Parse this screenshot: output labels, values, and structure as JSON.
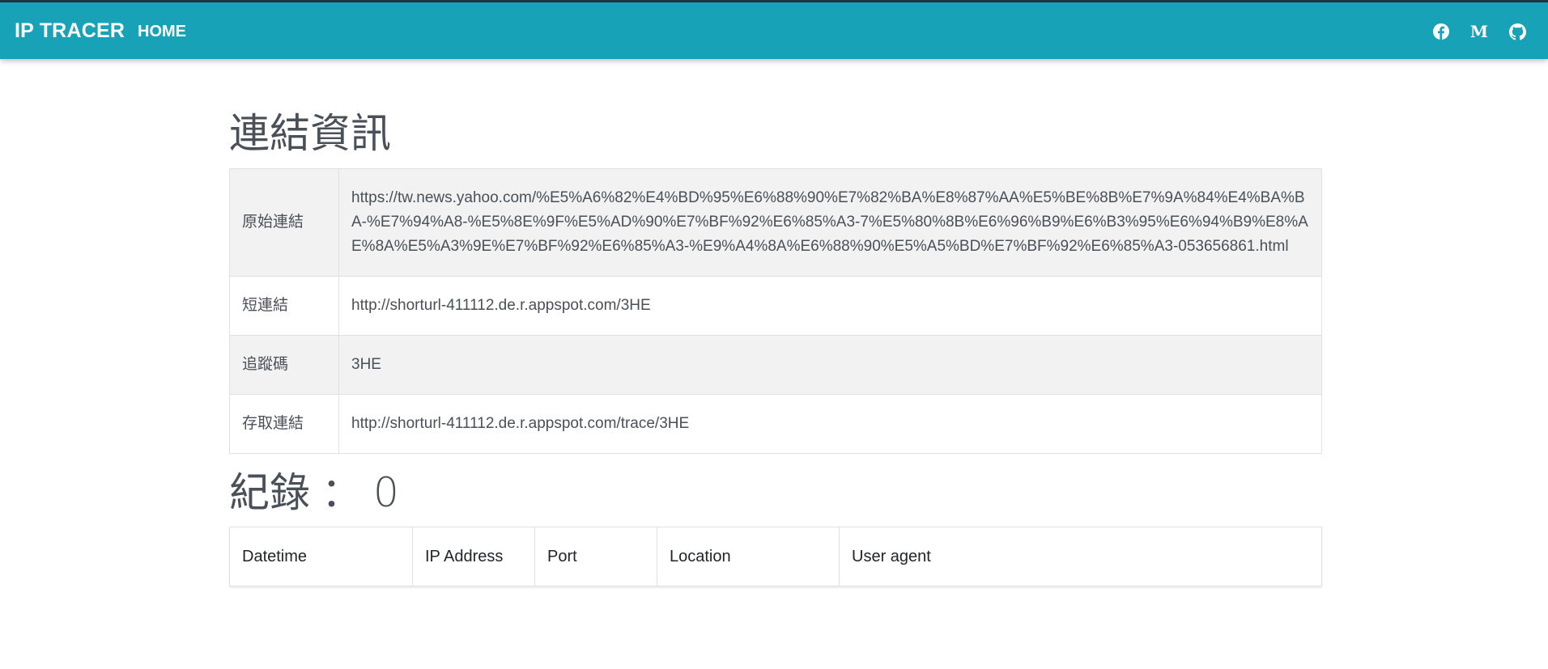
{
  "navbar": {
    "brand": "IP TRACER",
    "home": "HOME",
    "icons": [
      "facebook-icon",
      "medium-icon",
      "github-icon"
    ],
    "color": "#17a2b8"
  },
  "info": {
    "title": "連結資訊",
    "rows": [
      {
        "label": "原始連結",
        "value": "https://tw.news.yahoo.com/%E5%A6%82%E4%BD%95%E6%88%90%E7%82%BA%E8%87%AA%E5%BE%8B%E7%9A%84%E4%BA%BA-%E7%94%A8-%E5%8E%9F%E5%AD%90%E7%BF%92%E6%85%A3-7%E5%80%8B%E6%96%B9%E6%B3%95%E6%94%B9%E8%AE%8A%E5%A3%9E%E7%BF%92%E6%85%A3-%E9%A4%8A%E6%88%90%E5%A5%BD%E7%BF%92%E6%85%A3-053656861.html"
      },
      {
        "label": "短連結",
        "value": "http://shorturl-411112.de.r.appspot.com/3HE"
      },
      {
        "label": "追蹤碼",
        "value": "3HE"
      },
      {
        "label": "存取連結",
        "value": "http://shorturl-411112.de.r.appspot.com/trace/3HE"
      }
    ]
  },
  "records": {
    "title": "紀錄",
    "separator": "：",
    "count": "0",
    "columns": [
      "Datetime",
      "IP Address",
      "Port",
      "Location",
      "User agent"
    ]
  }
}
